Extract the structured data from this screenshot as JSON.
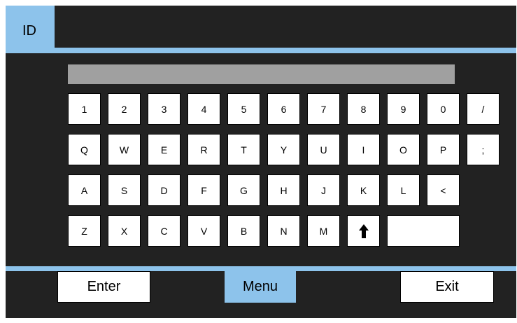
{
  "header": {
    "title": "ID"
  },
  "input": {
    "value": ""
  },
  "keyboard": {
    "row1": [
      "1",
      "2",
      "3",
      "4",
      "5",
      "6",
      "7",
      "8",
      "9",
      "0",
      "/"
    ],
    "row2": [
      "Q",
      "W",
      "E",
      "R",
      "T",
      "Y",
      "U",
      "I",
      "O",
      "P",
      ";"
    ],
    "row3": [
      "A",
      "S",
      "D",
      "F",
      "G",
      "H",
      "J",
      "K",
      "L",
      "<"
    ],
    "row4": [
      "Z",
      "X",
      "C",
      "V",
      "B",
      "N",
      "M"
    ],
    "shift_icon": "up-arrow-icon"
  },
  "footer": {
    "enter_label": "Enter",
    "menu_label": "Menu",
    "exit_label": "Exit"
  },
  "colors": {
    "accent": "#8dc3eb",
    "background": "#222222",
    "input_bar": "#a0a0a0"
  }
}
